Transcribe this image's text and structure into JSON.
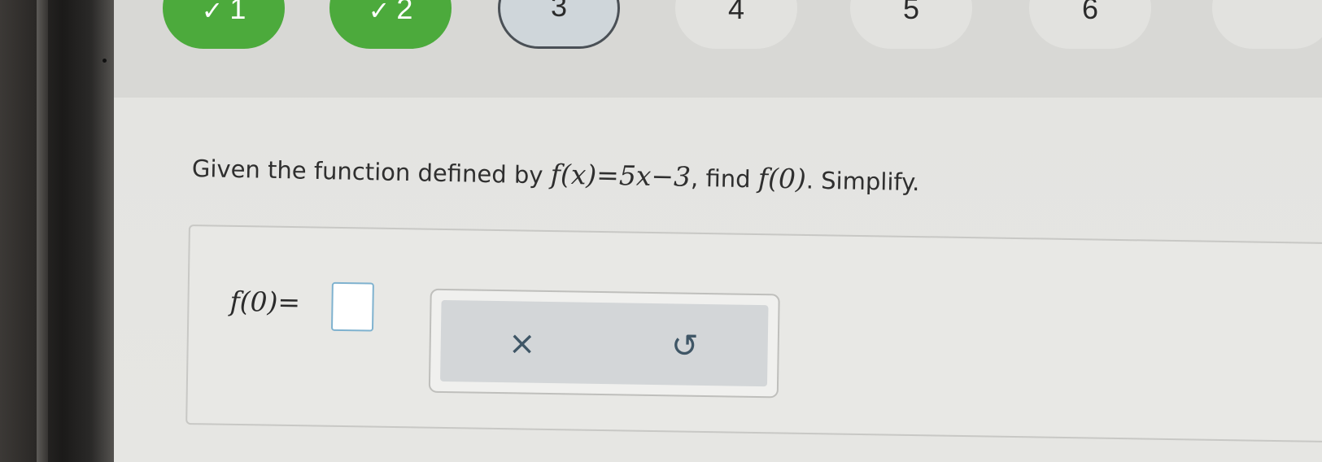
{
  "nav": {
    "items": [
      {
        "label": "1",
        "status": "done"
      },
      {
        "label": "2",
        "status": "done"
      },
      {
        "label": "3",
        "status": "current"
      },
      {
        "label": "4",
        "status": "todo"
      },
      {
        "label": "5",
        "status": "todo"
      },
      {
        "label": "6",
        "status": "todo"
      }
    ],
    "check_glyph": "✓"
  },
  "question": {
    "prefix": "Given the function defined by ",
    "function": "f(x)=5x−3",
    "middle": ", find ",
    "target": "f(0)",
    "suffix": ". Simplify."
  },
  "answer": {
    "label": "f(0)=",
    "value": ""
  },
  "keypad": {
    "clear_glyph": "×",
    "undo_glyph": "↺"
  },
  "colors": {
    "done": "#4caa3c",
    "current_border": "#4a5056",
    "input_border": "#7fb2cf"
  }
}
